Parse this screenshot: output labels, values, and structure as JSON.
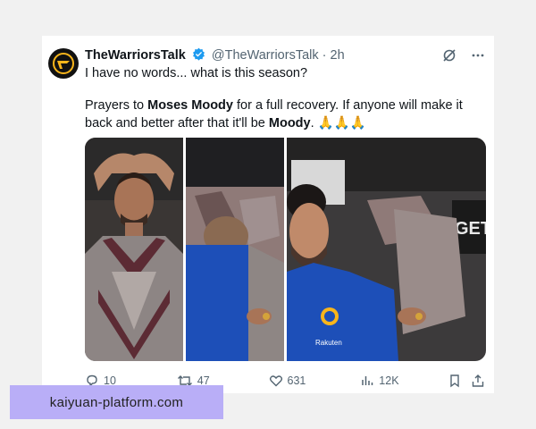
{
  "tweet": {
    "author_name": "TheWarriorsTalk",
    "handle": "@TheWarriorsTalk",
    "separator": "·",
    "time": "2h",
    "line1": "I have no words... what is this season?",
    "body": {
      "prefix": "Prayers to ",
      "bold_name": "Moses Moody",
      "middle": " for a full recovery. If anyone will make it back and better after that it'll be ",
      "bold_short": "Moody",
      "suffix": ". ",
      "emoji": "🙏🙏🙏"
    }
  },
  "media": {
    "panel_right_sign": "GET",
    "jersey_sponsor": "Rakuten"
  },
  "actions": {
    "replies": "10",
    "retweets": "47",
    "likes": "631",
    "views": "12K"
  },
  "icons": {
    "verified": "verified-badge-icon",
    "grok": "grok-icon",
    "more": "more-icon",
    "reply": "reply-icon",
    "retweet": "retweet-icon",
    "like": "heart-icon",
    "views": "views-icon",
    "bookmark": "bookmark-icon",
    "share": "share-icon"
  },
  "colors": {
    "verified": "#1d9bf0",
    "muted": "#536471",
    "watermark_bg": "#b9aef7",
    "warriors_blue": "#1d4fb8"
  },
  "watermark": "kaiyuan-platform.com"
}
